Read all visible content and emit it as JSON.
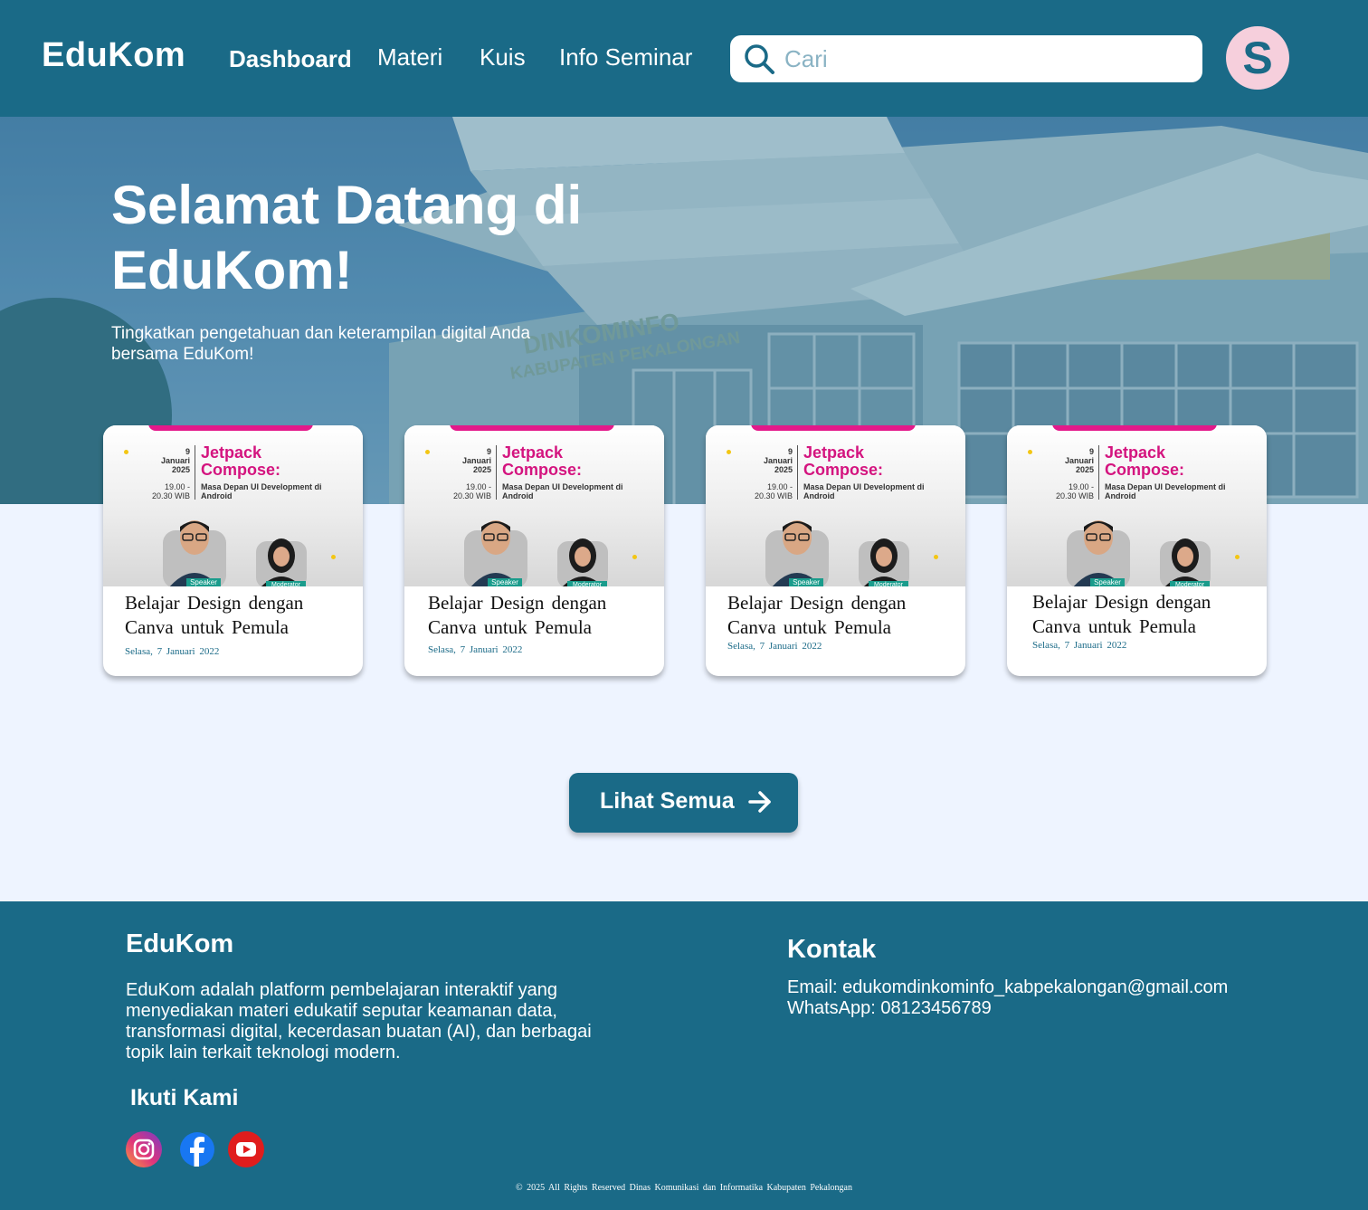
{
  "nav": {
    "logo": "EduKom",
    "links": [
      "Dashboard",
      "Materi",
      "Kuis",
      "Info Seminar"
    ],
    "active": "Dashboard",
    "search_placeholder": "Cari",
    "avatar_initial": "S"
  },
  "hero": {
    "title": "Selamat Datang di EduKom!",
    "subtitle": "Tingkatkan pengetahuan dan keterampilan digital Anda bersama EduKom!",
    "building_sign_1": "DINKOMINFO",
    "building_sign_2": "KABUPATEN PEKALONGAN"
  },
  "cards": [
    {
      "poster": {
        "day": "9",
        "month": "Januari",
        "year": "2025",
        "time": "19.00 - 20.30 WIB",
        "title_1": "Jetpack",
        "title_2": "Compose:",
        "desc": "Masa Depan UI Development di Android",
        "speaker_label": "Speaker",
        "moderator_label": "Moderator"
      },
      "title": "Belajar Design dengan Canva untuk Pemula",
      "date": "Selasa, 7 Januari 2022"
    },
    {
      "poster": {
        "day": "9",
        "month": "Januari",
        "year": "2025",
        "time": "19.00 - 20.30 WIB",
        "title_1": "Jetpack",
        "title_2": "Compose:",
        "desc": "Masa Depan UI Development di Android",
        "speaker_label": "Speaker",
        "moderator_label": "Moderator"
      },
      "title": "Belajar Design dengan Canva untuk Pemula",
      "date": "Selasa, 7 Januari 2022"
    },
    {
      "poster": {
        "day": "9",
        "month": "Januari",
        "year": "2025",
        "time": "19.00 - 20.30 WIB",
        "title_1": "Jetpack",
        "title_2": "Compose:",
        "desc": "Masa Depan UI Development di Android",
        "speaker_label": "Speaker",
        "moderator_label": "Moderator"
      },
      "title": "Belajar Design dengan Canva untuk Pemula",
      "date": "Selasa, 7 Januari 2022"
    },
    {
      "poster": {
        "day": "9",
        "month": "Januari",
        "year": "2025",
        "time": "19.00 - 20.30 WIB",
        "title_1": "Jetpack",
        "title_2": "Compose:",
        "desc": "Masa Depan UI Development di Android",
        "speaker_label": "Speaker",
        "moderator_label": "Moderator"
      },
      "title": "Belajar Design dengan Canva untuk Pemula",
      "date": "Selasa, 7 Januari 2022"
    }
  ],
  "cta": {
    "label": "Lihat Semua",
    "icon": "arrow-right-icon"
  },
  "footer": {
    "brand": "EduKom",
    "description": "EduKom adalah platform pembelajaran interaktif yang menyediakan materi edukatif seputar keamanan data, transformasi digital, kecerdasan buatan (AI), dan berbagai topik lain terkait teknologi modern.",
    "follow_title": "Ikuti Kami",
    "social": [
      "instagram-icon",
      "facebook-icon",
      "youtube-icon"
    ],
    "contact_title": "Kontak",
    "email": "Email: edukomdinkominfo_kabpekalongan@gmail.com",
    "whatsapp": "WhatsApp: 08123456789",
    "copyright": "© 2025 All Rights Reserved Dinas Komunikasi dan Informatika Kabupaten Pekalongan"
  },
  "colors": {
    "primary": "#1a6a87",
    "page_bg": "#eef4ff",
    "avatar_bg": "#f6cfdc",
    "poster_accent": "#e3198a"
  }
}
